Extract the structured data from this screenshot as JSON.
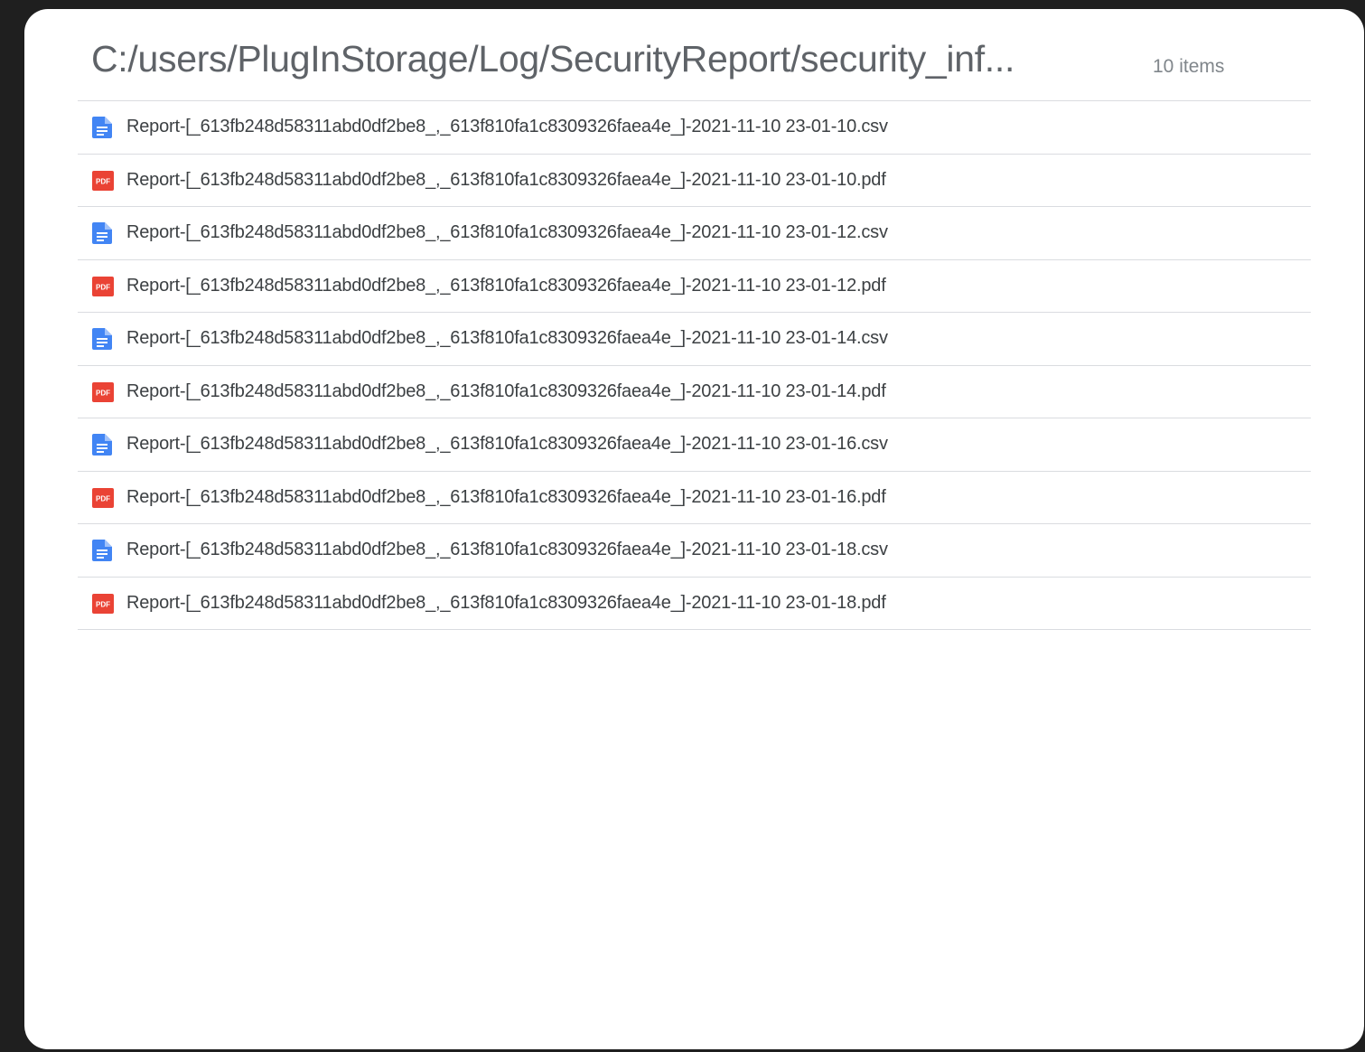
{
  "header": {
    "path": "C:/users/PlugInStorage/Log/SecurityReport/security_inf...",
    "item_count": "10 items"
  },
  "files": [
    {
      "name": "Report-[_613fb248d58311abd0df2be8_,_613f810fa1c8309326faea4e_]-2021-11-10 23-01-10.csv",
      "type": "doc-icon"
    },
    {
      "name": "Report-[_613fb248d58311abd0df2be8_,_613f810fa1c8309326faea4e_]-2021-11-10 23-01-10.pdf",
      "type": "pdf-icon"
    },
    {
      "name": "Report-[_613fb248d58311abd0df2be8_,_613f810fa1c8309326faea4e_]-2021-11-10 23-01-12.csv",
      "type": "doc-icon"
    },
    {
      "name": "Report-[_613fb248d58311abd0df2be8_,_613f810fa1c8309326faea4e_]-2021-11-10 23-01-12.pdf",
      "type": "pdf-icon"
    },
    {
      "name": "Report-[_613fb248d58311abd0df2be8_,_613f810fa1c8309326faea4e_]-2021-11-10 23-01-14.csv",
      "type": "doc-icon"
    },
    {
      "name": "Report-[_613fb248d58311abd0df2be8_,_613f810fa1c8309326faea4e_]-2021-11-10 23-01-14.pdf",
      "type": "pdf-icon"
    },
    {
      "name": "Report-[_613fb248d58311abd0df2be8_,_613f810fa1c8309326faea4e_]-2021-11-10 23-01-16.csv",
      "type": "doc-icon"
    },
    {
      "name": "Report-[_613fb248d58311abd0df2be8_,_613f810fa1c8309326faea4e_]-2021-11-10 23-01-16.pdf",
      "type": "pdf-icon"
    },
    {
      "name": "Report-[_613fb248d58311abd0df2be8_,_613f810fa1c8309326faea4e_]-2021-11-10 23-01-18.csv",
      "type": "doc-icon"
    },
    {
      "name": "Report-[_613fb248d58311abd0df2be8_,_613f810fa1c8309326faea4e_]-2021-11-10 23-01-18.pdf",
      "type": "pdf-icon"
    }
  ],
  "colors": {
    "doc_icon": "#4285f4",
    "pdf_icon": "#ea4335"
  },
  "pdf_icon_label": "PDF"
}
